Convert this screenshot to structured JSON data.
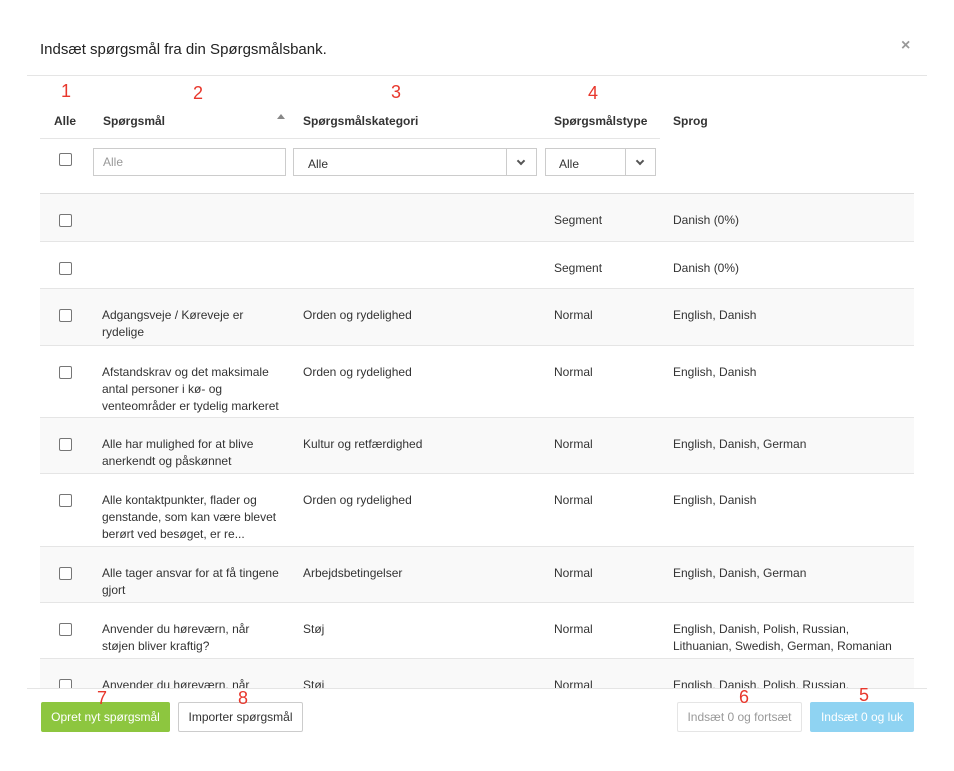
{
  "modal": {
    "title": "Indsæt spørgsmål fra din Spørgsmålsbank.",
    "close_icon": "close-icon",
    "close_glyph": "×"
  },
  "annotations": [
    "1",
    "2",
    "3",
    "4",
    "5",
    "6",
    "7",
    "8"
  ],
  "table": {
    "headers": {
      "all": "Alle",
      "question": "Spørgsmål",
      "category": "Spørgsmålskategori",
      "type": "Spørgsmålstype",
      "language": "Sprog"
    },
    "sort_icon": "sort-up-icon",
    "filters": {
      "question_placeholder": "Alle",
      "category_value": "Alle",
      "type_value": "Alle"
    },
    "rows": [
      {
        "question": "",
        "category": "",
        "type": "Segment",
        "language": "Danish (0%)"
      },
      {
        "question": "",
        "category": "",
        "type": "Segment",
        "language": "Danish (0%)"
      },
      {
        "question": "Adgangsveje / Køreveje er rydelige",
        "category": "Orden og rydelighed",
        "type": "Normal",
        "language": "English, Danish"
      },
      {
        "question": "Afstandskrav og det maksimale antal personer i kø- og venteområder er tydelig markeret",
        "category": "Orden og rydelighed",
        "type": "Normal",
        "language": "English, Danish"
      },
      {
        "question": "Alle har mulighed for at blive anerkendt og påskønnet",
        "category": "Kultur og retfærdighed",
        "type": "Normal",
        "language": "English, Danish, German"
      },
      {
        "question": "Alle kontaktpunkter, flader og genstande, som kan være blevet berørt ved besøget, er re...",
        "category": "Orden og rydelighed",
        "type": "Normal",
        "language": "English, Danish"
      },
      {
        "question": "Alle tager ansvar for at få tingene gjort",
        "category": "Arbejdsbetingelser",
        "type": "Normal",
        "language": "English, Danish, German"
      },
      {
        "question": "Anvender du høreværn, når støjen bliver kraftig?",
        "category": "Støj",
        "type": "Normal",
        "language": "English, Danish, Polish, Russian, Lithuanian, Swedish, German, Romanian"
      },
      {
        "question": "Anvender du høreværn, når",
        "category": "Støj",
        "type": "Normal",
        "language": "English, Danish, Polish, Russian,"
      }
    ]
  },
  "footer": {
    "create_label": "Opret nyt spørgsmål",
    "import_label": "Importer spørgsmål",
    "insert_continue_label": "Indsæt 0 og fortsæt",
    "insert_close_label": "Indsæt 0 og luk"
  },
  "colors": {
    "annotation": "#e8372c",
    "green_button": "#8dc63f",
    "blue_button": "#8fd3f2"
  }
}
